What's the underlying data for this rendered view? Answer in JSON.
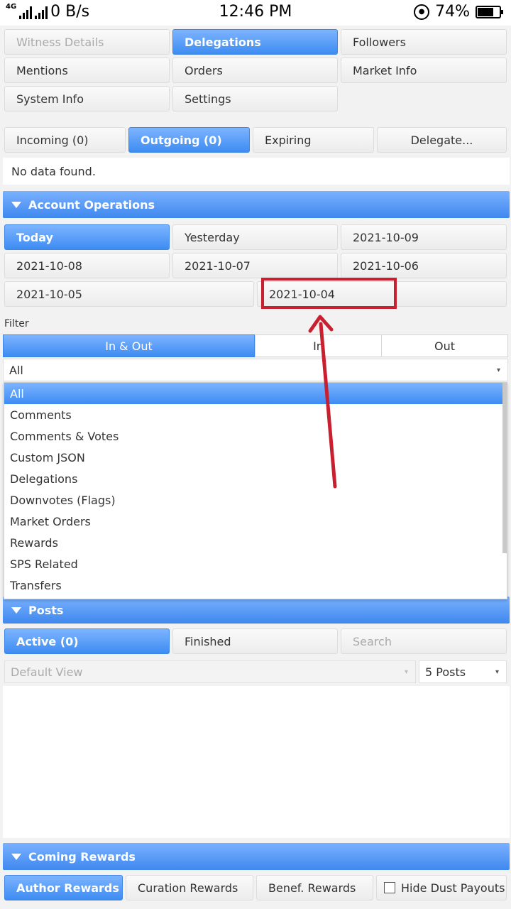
{
  "statusbar": {
    "network": "4G",
    "speed": "0 B/s",
    "time": "12:46 PM",
    "battery": "74%",
    "battery_level": 0.74
  },
  "top_menu": {
    "witness_details": "Witness Details",
    "delegations": "Delegations",
    "followers": "Followers",
    "mentions": "Mentions",
    "orders": "Orders",
    "market_info": "Market Info",
    "system_info": "System Info",
    "settings": "Settings"
  },
  "delegation_tabs": {
    "incoming": "Incoming (0)",
    "outgoing": "Outgoing (0)",
    "expiring": "Expiring",
    "delegate": "Delegate..."
  },
  "delegation_empty": "No data found.",
  "account_operations": {
    "title": "Account Operations",
    "dates": [
      "Today",
      "Yesterday",
      "2021-10-09",
      "2021-10-08",
      "2021-10-07",
      "2021-10-06",
      "2021-10-05",
      "2021-10-04"
    ],
    "filter_label": "Filter",
    "direction": [
      "In & Out",
      "In",
      "Out"
    ],
    "selected_type": "All",
    "types": [
      "All",
      "Comments",
      "Comments & Votes",
      "Custom JSON",
      "Delegations",
      "Downvotes (Flags)",
      "Market Orders",
      "Rewards",
      "SPS Related",
      "Transfers"
    ]
  },
  "posts": {
    "title": "Posts",
    "active": "Active (0)",
    "finished": "Finished",
    "search_placeholder": "Search",
    "view": "Default View",
    "count": "5 Posts"
  },
  "coming_rewards": {
    "title": "Coming Rewards",
    "author": "Author Rewards",
    "curation": "Curation Rewards",
    "benef": "Benef. Rewards",
    "hide_dust": "Hide Dust Payouts"
  },
  "colors": {
    "accent": "#3d8cf2",
    "annotation": "#c8202f"
  }
}
